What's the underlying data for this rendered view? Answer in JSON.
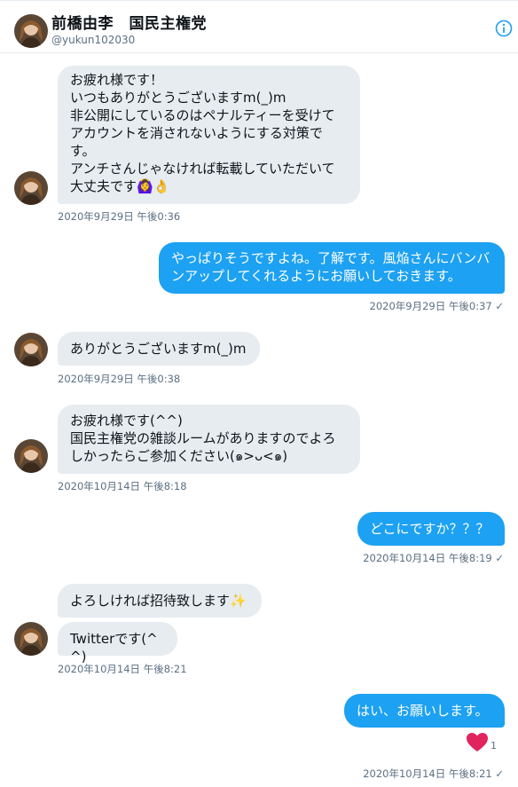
{
  "header": {
    "name": "前橋由李　国民主権党",
    "handle": "@yukun102030"
  },
  "messages": [
    {
      "text": "お疲れ様です！\nいつもありがとうございますm(_)m\n非公開にしているのはペナルティーを受けてアカウントを消されないようにする対策です。\nアンチさんじゃなければ転載していただいて大丈夫です🙆‍♀️👌",
      "time": "2020年9月29日 午後0:36"
    },
    {
      "text": "やっぱりそうですよね。了解です。風焔さんにバンバンアップしてくれるようにお願いしておきます。",
      "time": "2020年9月29日 午後0:37 ✓"
    },
    {
      "text": "ありがとうございますm(_)m",
      "time": "2020年9月29日 午後0:38"
    },
    {
      "text": "お疲れ様です(^^)\n国民主権党の雑談ルームがありますのでよろしかったらご参加ください(๑>ᴗ<๑)",
      "time": "2020年10月14日 午後8:18"
    },
    {
      "text": "どこにですか？？？",
      "time": "2020年10月14日 午後8:19 ✓"
    },
    {
      "text": "よろしければ招待致します✨",
      "time": ""
    },
    {
      "text": "Twitterです(^^)",
      "time": "2020年10月14日 午後8:21"
    },
    {
      "text": "はい、お願いします。",
      "time": "2020年10月14日 午後8:21 ✓"
    }
  ],
  "reaction": {
    "icon": "heart-icon",
    "count": "1",
    "color": "#e0245e"
  },
  "colors": {
    "sent_bubble": "#1da1f2",
    "received_bubble": "#e6ecf0",
    "meta_text": "#5b7083"
  }
}
